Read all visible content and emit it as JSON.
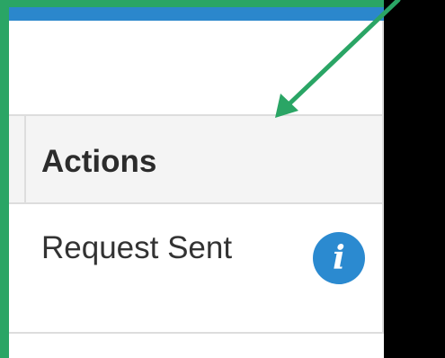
{
  "table": {
    "header": {
      "actions_label": "Actions"
    },
    "rows": [
      {
        "status": "Request Sent",
        "icon": "info-icon"
      }
    ]
  },
  "colors": {
    "top_bar": "#2b87cc",
    "annotation": "#2aa565",
    "info_icon": "#2b8ad0",
    "header_background": "#f4f4f4",
    "border": "#dddddd"
  }
}
